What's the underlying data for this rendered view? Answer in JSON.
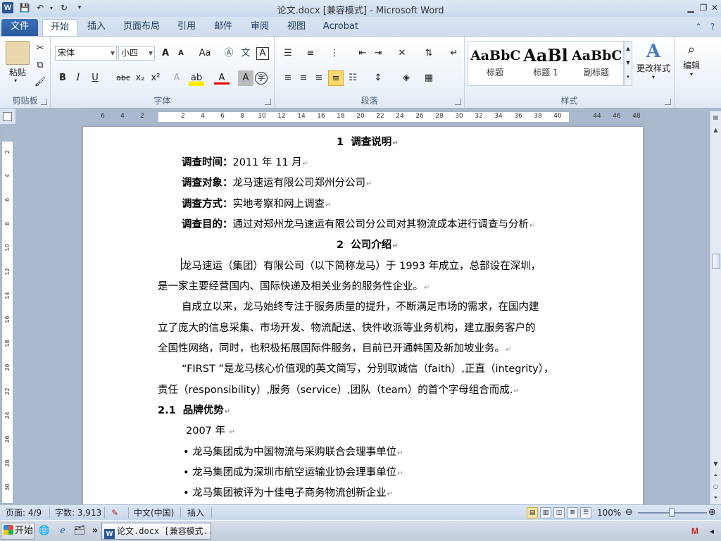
{
  "window": {
    "title": "论文.docx [兼容模式] - Microsoft Word",
    "app_icon": "W"
  },
  "ribbon_tabs": [
    "文件",
    "开始",
    "插入",
    "页面布局",
    "引用",
    "邮件",
    "审阅",
    "视图",
    "Acrobat"
  ],
  "ribbon": {
    "clipboard": {
      "label": "剪贴板",
      "paste": "粘贴"
    },
    "font": {
      "label": "字体",
      "font_name": "宋体",
      "font_size": "小四",
      "grow": "A",
      "shrink": "A",
      "change_case": "Aa",
      "bold": "B",
      "italic": "I",
      "underline": "U",
      "strike": "abc",
      "subscript": "x₂",
      "superscript": "x²",
      "font_color": "A",
      "char_shading": "A",
      "enclose": "字"
    },
    "paragraph": {
      "label": "段落"
    },
    "styles": {
      "label": "样式",
      "items": [
        {
          "sample": "AaBbC",
          "name": "标题"
        },
        {
          "sample": "AaBl",
          "name": "标题 1"
        },
        {
          "sample": "AaBbC",
          "name": "副标题"
        }
      ],
      "change_styles": "更改样式"
    },
    "editing": {
      "label": "编辑"
    }
  },
  "ruler": {
    "h_ticks": [
      "6",
      "4",
      "2",
      "2",
      "4",
      "6",
      "8",
      "10",
      "12",
      "14",
      "16",
      "18",
      "20",
      "22",
      "24",
      "26",
      "28",
      "30",
      "32",
      "34",
      "36",
      "38",
      "40",
      "44",
      "46",
      "48"
    ],
    "v_ticks": [
      "2",
      "4",
      "6",
      "8",
      "10",
      "12",
      "14",
      "16",
      "18",
      "20",
      "22",
      "24",
      "26",
      "28",
      "30"
    ]
  },
  "document": {
    "heading1": {
      "num": "1",
      "text": "调查说明"
    },
    "fields": [
      {
        "label": "调查时间：",
        "value": "2011 年 11 月"
      },
      {
        "label": "调查对象：",
        "value": "龙马速运有限公司郑州分公司"
      },
      {
        "label": "调查方式：",
        "value": "实地考察和网上调查"
      },
      {
        "label": "调查目的：",
        "value": "通过对郑州龙马速运有限公司分公司对其物流成本进行调查与分析"
      }
    ],
    "heading2": {
      "num": "2",
      "text": "公司介绍"
    },
    "lines": [
      "龙马速运（集团）有限公司（以下简称龙马）于 1993 年成立，总部设在深圳，",
      "是一家主要经营国内、国际快递及相关业务的服务性企业。",
      "自成立以来，龙马始终专注于服务质量的提升，不断满足市场的需求，在国内建",
      "立了庞大的信息采集、市场开发、物流配送、快件收派等业务机构，建立服务客户的",
      "全国性网络，同时，也积极拓展国际件服务，目前已开通韩国及新加坡业务。",
      "“FIRST ”是龙马核心价值观的英文简写，分别取诚信（faith）,正直（integrity），",
      "责任（responsibility）,服务（service）,团队（team）的首个字母组合而成."
    ],
    "heading21": {
      "num": "2.1",
      "text": "品牌优势"
    },
    "year": "2007 年",
    "bullets": [
      "龙马集团成为中国物流与采购联合会理事单位",
      "龙马集团成为深圳市航空运输业协会理事单位",
      "龙马集团被评为十佳电子商务物流创新企业"
    ],
    "para_mark": "↵"
  },
  "status": {
    "page": "页面: 4/9",
    "words": "字数: 3,913",
    "language": "中文(中国)",
    "mode": "插入",
    "zoom": "100%"
  },
  "taskbar": {
    "start": "开始",
    "word_task": "论文.docx [兼容模式..."
  }
}
